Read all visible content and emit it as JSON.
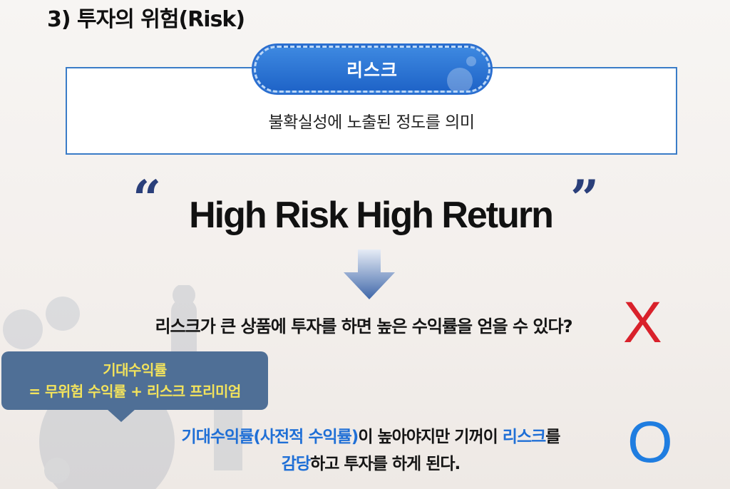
{
  "heading": "3) 투자의 위험(Risk)",
  "definition": {
    "label": "리스크",
    "text": "불확실성에 노출된 정도를 의미"
  },
  "quote_open": "“",
  "quote_close": "”",
  "headline": "High Risk High Return",
  "question": "리스크가 큰 상품에 투자를 하면 높은 수익률을 얻을 수 있다?",
  "wrong_mark": "X",
  "callout": {
    "line1": "기대수익률",
    "line2": "= 무위험 수익률 + 리스크 프리미엄"
  },
  "answer": {
    "part1": "기대수익률(사전적 수익률)",
    "part2": "이 높아야지만 기꺼이 ",
    "part3": "리스크",
    "part4": "를",
    "part5": "감당",
    "part6": "하고 투자를 하게 된다."
  },
  "right_mark": "O",
  "colors": {
    "accent_blue": "#1f6fd6",
    "pill_blue": "#2b6fd0",
    "wrong_red": "#d9212b",
    "callout_bg": "#4f6f96",
    "callout_text": "#f3e35c"
  }
}
